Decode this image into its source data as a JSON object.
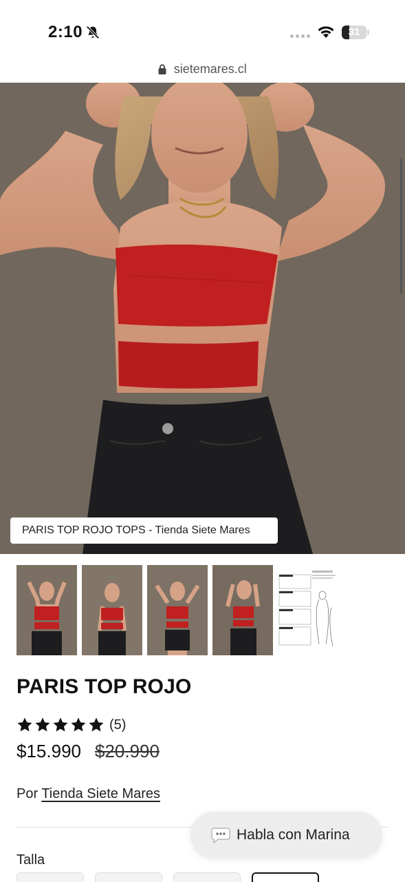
{
  "status_bar": {
    "time": "2:10",
    "battery_level": "31",
    "battery_fill": 0.31
  },
  "url_bar": {
    "domain": "sietemares.cl"
  },
  "hero": {
    "caption": "PARIS TOP ROJO TOPS - Tienda Siete Mares"
  },
  "product": {
    "title": "PARIS TOP ROJO",
    "rating_stars": 5,
    "rating_count": "(5)",
    "price": "$15.990",
    "compare_price": "$20.990",
    "vendor_prefix": "Por",
    "vendor_name": "Tienda Siete Mares"
  },
  "variants": {
    "label": "Talla"
  },
  "chat": {
    "label": "Habla con Marina"
  },
  "colors": {
    "top_red": "#c0201f",
    "jeans_black": "#1d1d1f",
    "wall": "#766b5f"
  }
}
